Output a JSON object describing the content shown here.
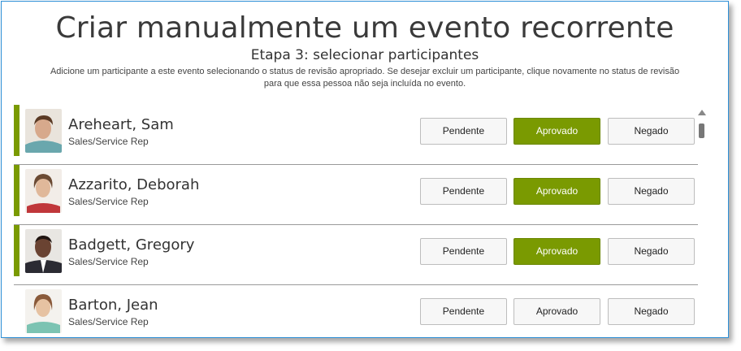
{
  "page": {
    "title": "Criar manualmente um evento recorrente",
    "subtitle": "Etapa 3: selecionar participantes",
    "description_line1": "Adicione um participante a este evento selecionando o status de revisão apropriado. Se desejar excluir um participante, clique novamente no status de revisão",
    "description_line2": "para que essa pessoa não seja incluída no evento."
  },
  "buttons": {
    "pending": "Pendente",
    "approved": "Aprovado",
    "denied": "Negado"
  },
  "colors": {
    "accent": "#7a9a01",
    "frame_border": "#2d8fd6"
  },
  "participants": [
    {
      "name": "Areheart, Sam",
      "role": "Sales/Service Rep",
      "status": "Aprovado",
      "selected": true
    },
    {
      "name": "Azzarito, Deborah",
      "role": "Sales/Service Rep",
      "status": "Aprovado",
      "selected": true
    },
    {
      "name": "Badgett, Gregory",
      "role": "Sales/Service Rep",
      "status": "Aprovado",
      "selected": true
    },
    {
      "name": "Barton, Jean",
      "role": "Sales/Service Rep",
      "status": "none",
      "selected": false
    }
  ]
}
